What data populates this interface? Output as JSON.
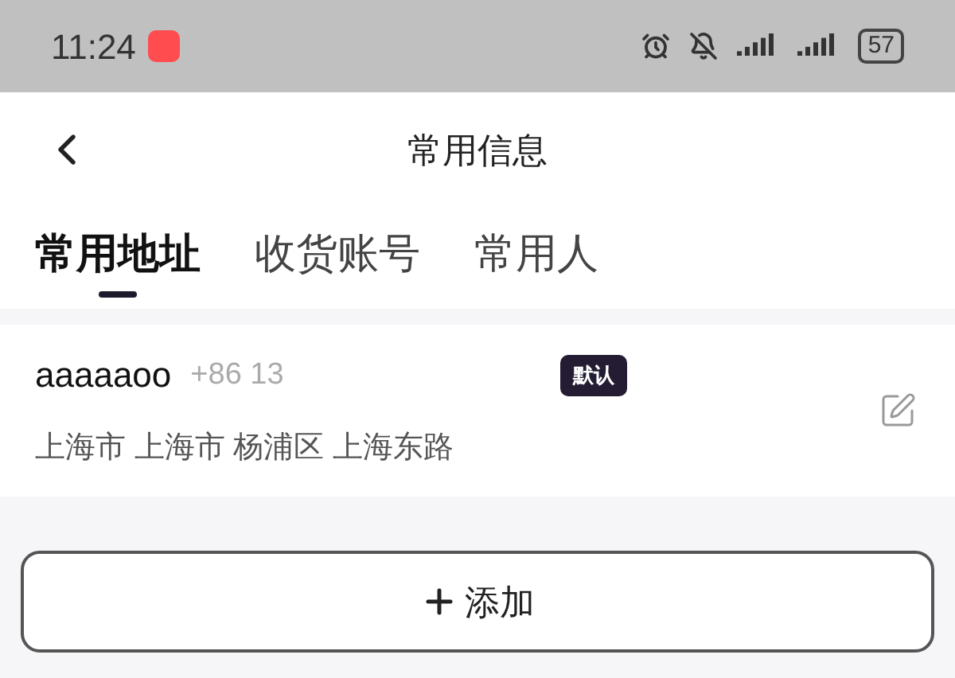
{
  "status_bar": {
    "time": "11:24",
    "battery": "57"
  },
  "header": {
    "title": "常用信息"
  },
  "tabs": [
    {
      "label": "常用地址",
      "selected": true
    },
    {
      "label": "收货账号",
      "selected": false
    },
    {
      "label": "常用人",
      "selected": false
    }
  ],
  "addresses": [
    {
      "name": "aaaaaoo",
      "phone": "+86 13",
      "badge": "默认",
      "address": "上海市 上海市 杨浦区 上海东路"
    }
  ],
  "add_button": {
    "label": "添加"
  }
}
